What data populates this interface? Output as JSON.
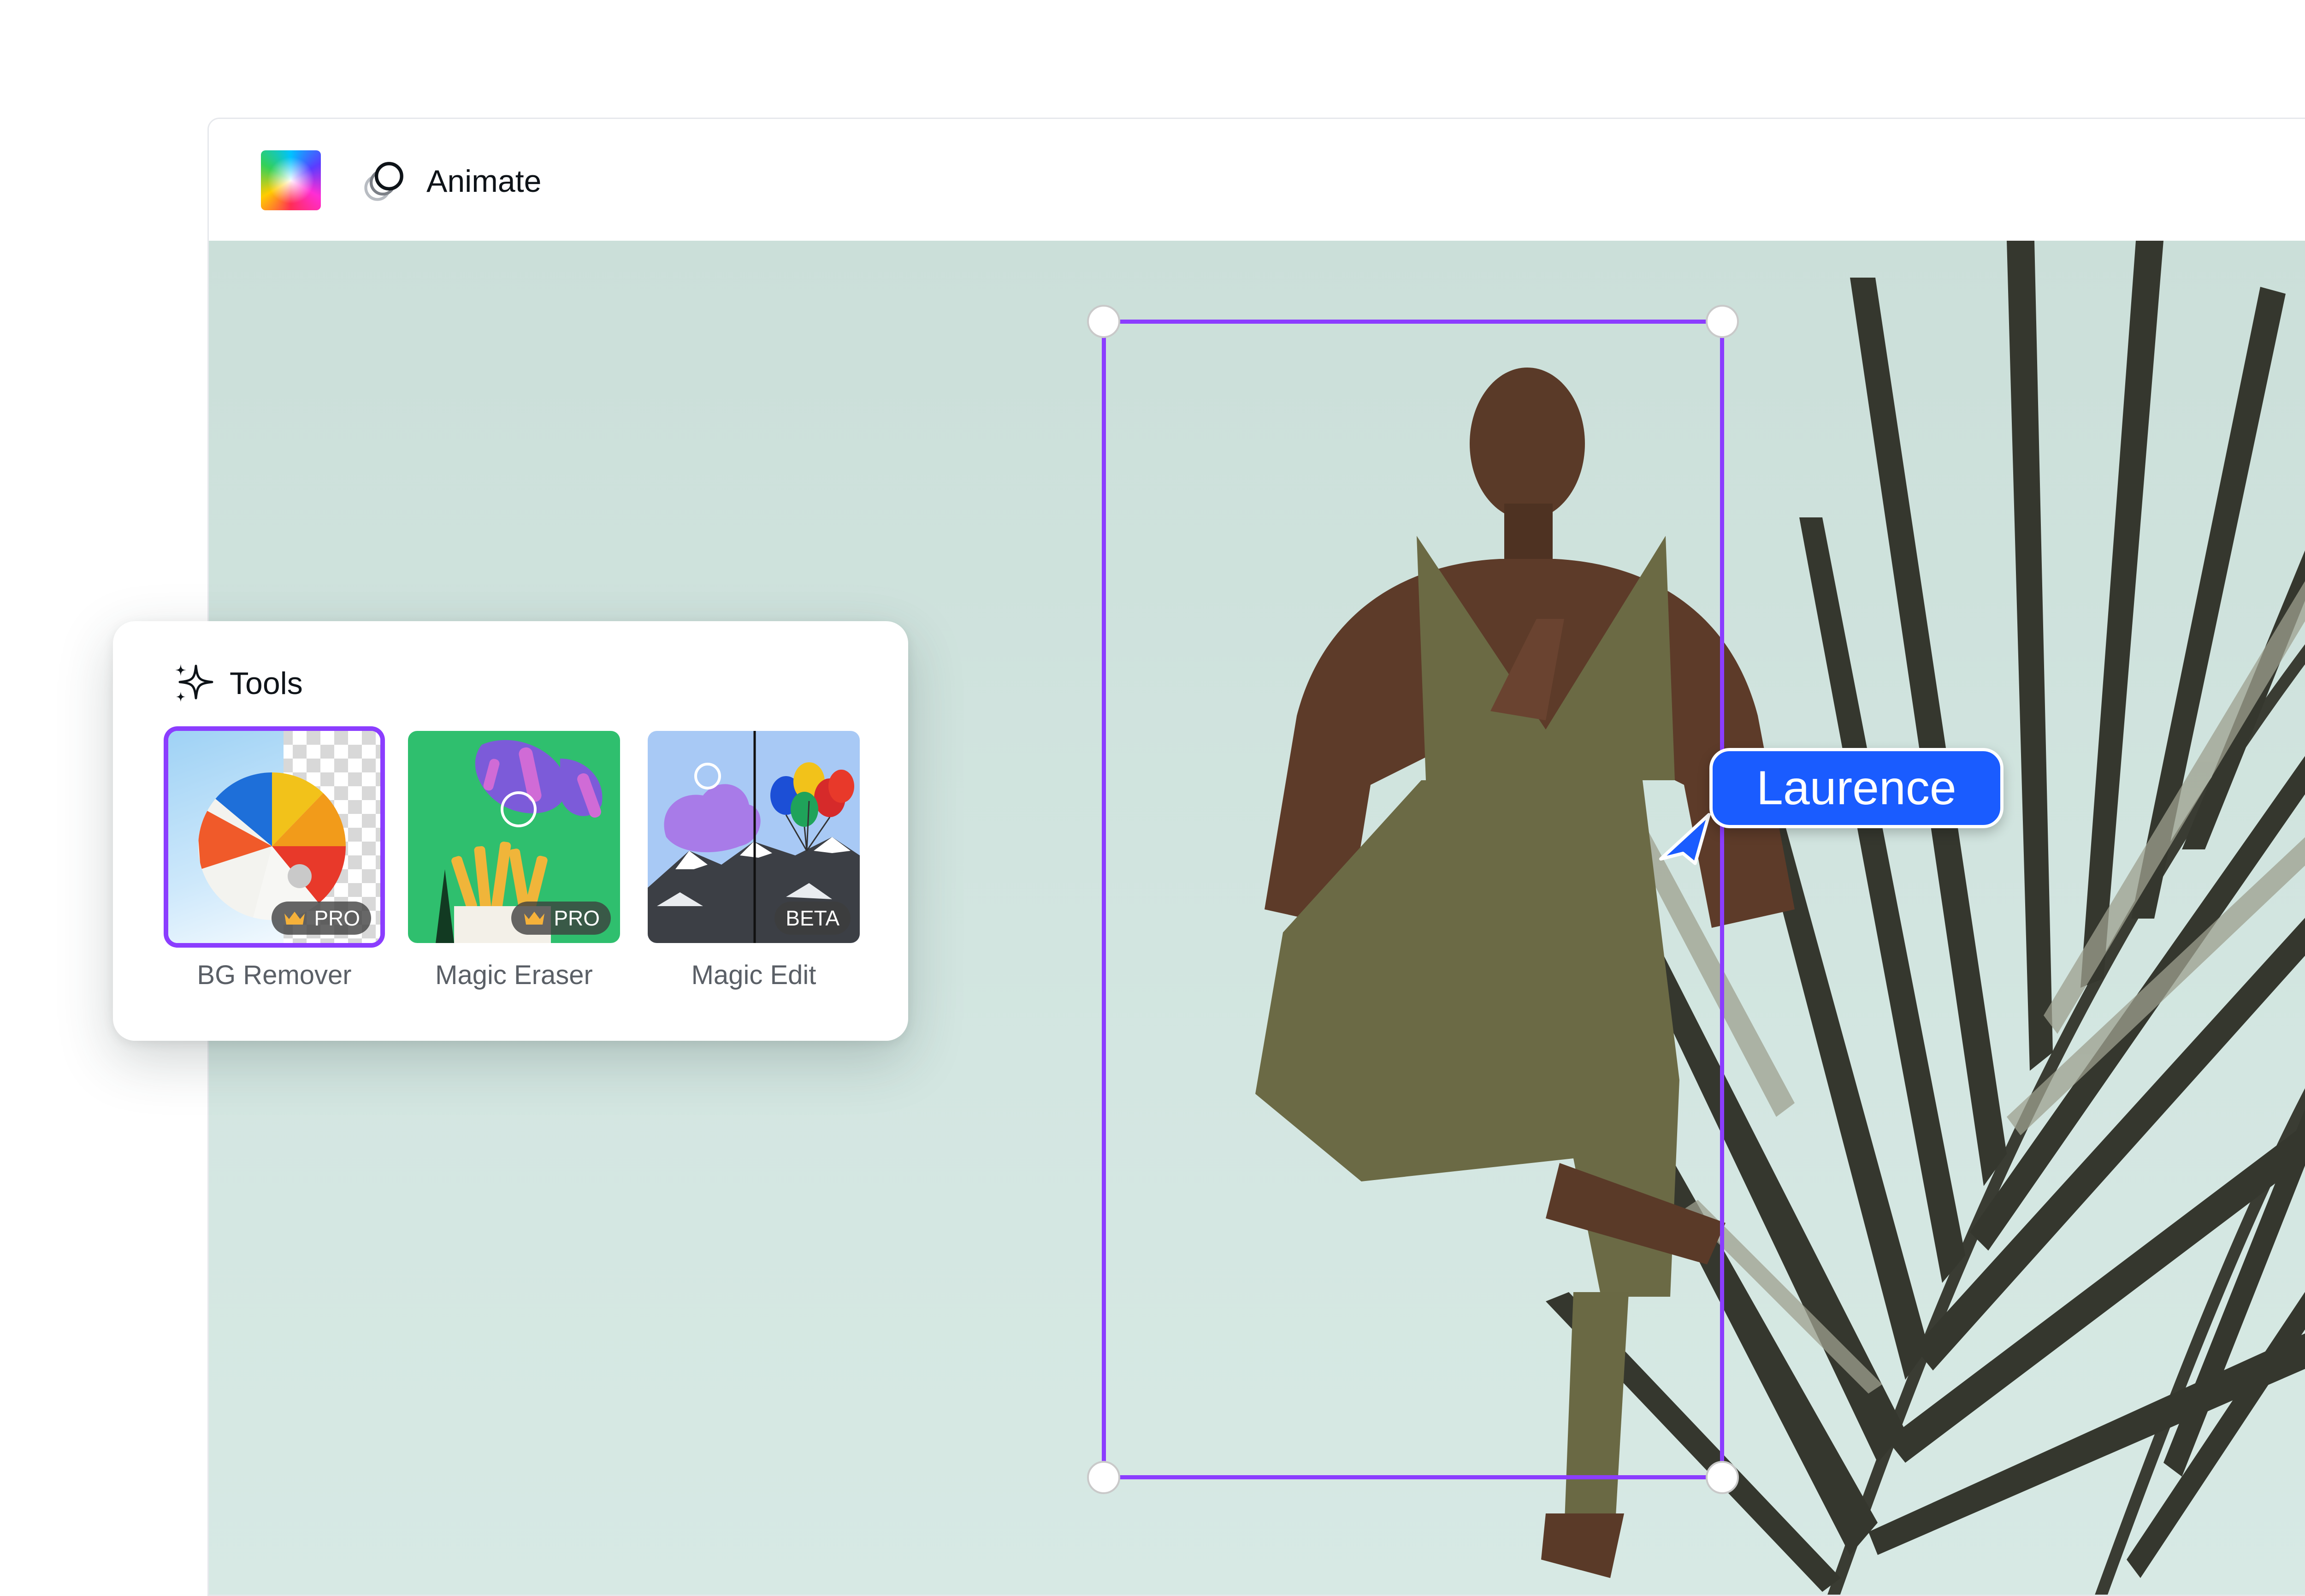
{
  "toolbar": {
    "animate_label": "Animate",
    "color_icon": "color-picker-icon",
    "animate_icon": "animate-icon"
  },
  "canvas": {
    "background_color": "#cfe3dd",
    "selection_color": "#8b3dff"
  },
  "collaborator": {
    "name": "Laurence",
    "color": "#1a5cff"
  },
  "tools_panel": {
    "title": "Tools",
    "icon": "sparkle-icon",
    "items": [
      {
        "label": "BG Remover",
        "badge": "PRO",
        "badge_icon": "crown-icon",
        "selected": true
      },
      {
        "label": "Magic Eraser",
        "badge": "PRO",
        "badge_icon": "crown-icon",
        "selected": false
      },
      {
        "label": "Magic Edit",
        "badge": "BETA",
        "badge_icon": "",
        "selected": false
      }
    ]
  }
}
